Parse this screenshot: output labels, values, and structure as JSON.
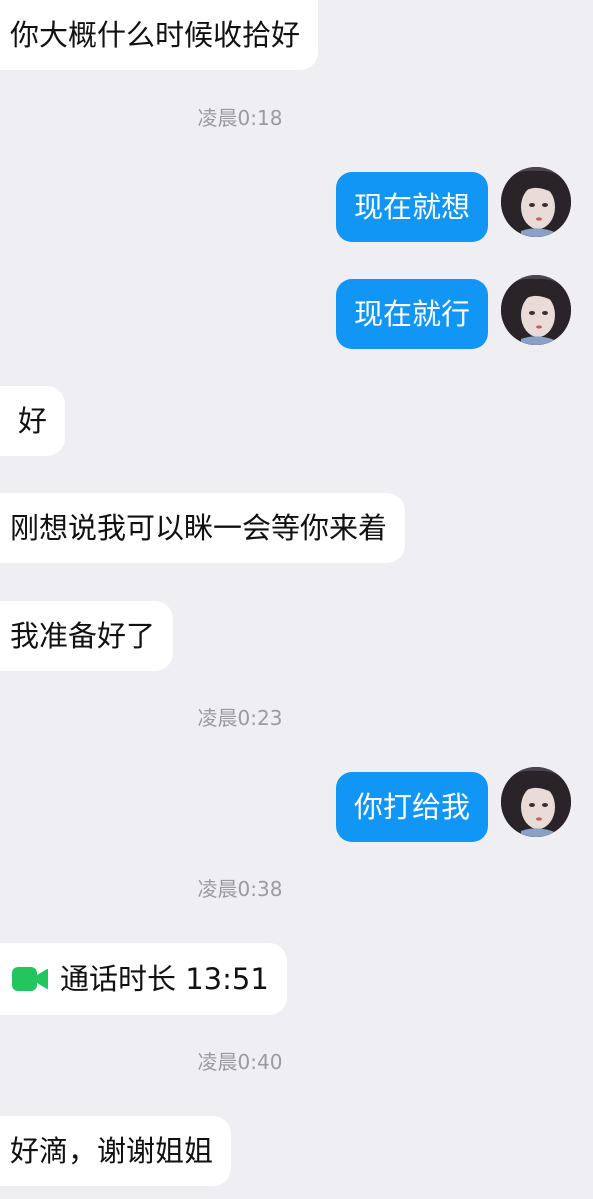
{
  "messages": [
    {
      "text": "你大概什么时候收拾好"
    },
    {
      "time": "凌晨0:18"
    },
    {
      "text": "现在就想"
    },
    {
      "text": "现在就行"
    },
    {
      "text": "好"
    },
    {
      "text": "刚想说我可以眯一会等你来着"
    },
    {
      "text": "我准备好了"
    },
    {
      "time": "凌晨0:23"
    },
    {
      "text": "你打给我"
    },
    {
      "time": "凌晨0:38"
    },
    {
      "call": {
        "label": "通话时长 13:51",
        "icon": "video-call-icon",
        "color": "#22c55e"
      }
    },
    {
      "time": "凌晨0:40"
    },
    {
      "text": "好滴，谢谢姐姐"
    }
  ],
  "colors": {
    "background": "#efeff3",
    "sent_bubble": "#1296f5",
    "received_bubble": "#ffffff",
    "timestamp": "#9a9aa0"
  }
}
